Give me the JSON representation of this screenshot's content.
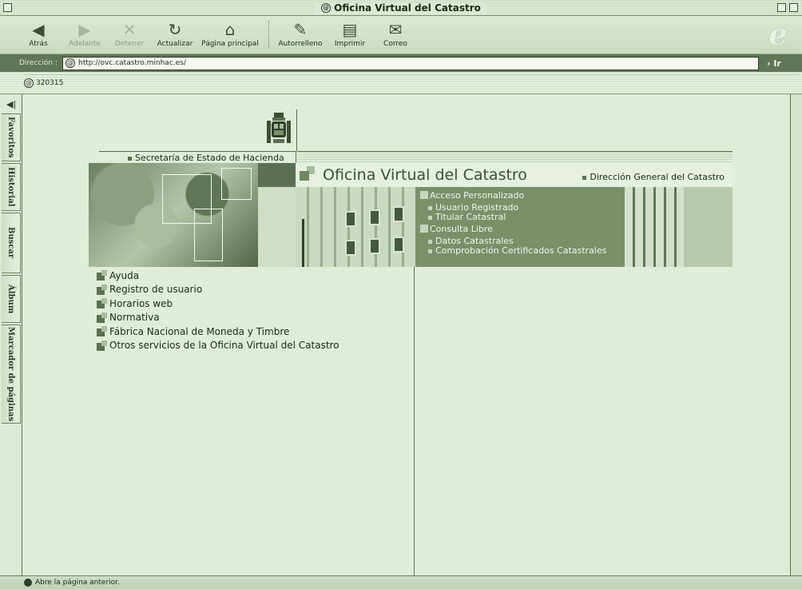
{
  "window": {
    "title": "Oficina Virtual del Catastro"
  },
  "toolbar": {
    "back": "Atrás",
    "forward": "Adelante",
    "stop": "Detener",
    "refresh": "Actualizar",
    "home": "Página principal",
    "autofill": "Autorrelleno",
    "print": "Imprimir",
    "mail": "Correo"
  },
  "address": {
    "label": "Dirección :",
    "url": "http://ovc.catastro.minhac.es/",
    "go": "Ir"
  },
  "favorites": {
    "item": "320315"
  },
  "sidebar": {
    "tabs": [
      "Favoritos",
      "Historial",
      "Buscar",
      "Álbum",
      "Marcador de páginas"
    ]
  },
  "page": {
    "secretaria": "Secretaría de Estado de Hacienda",
    "ovc_title": "Oficina Virtual del Catastro",
    "direccion_general": "Dirección General del Catastro",
    "acceso_personalizado": "Acceso Personalizado",
    "usuario_registrado": "Usuario Registrado",
    "titular_catastral": "Titular Catastral",
    "consulta_libre": "Consulta Libre",
    "datos_catastrales": "Datos Catastrales",
    "comprobacion": "Comprobación Certificados Catastrales",
    "links": [
      "Ayuda",
      "Registro de usuario",
      "Horarios web",
      "Normativa",
      "Fábrica Nacional de Moneda y Timbre",
      "Otros servicios de la Oficina Virtual del Catastro"
    ]
  },
  "status": {
    "text": "Abre la página anterior."
  }
}
